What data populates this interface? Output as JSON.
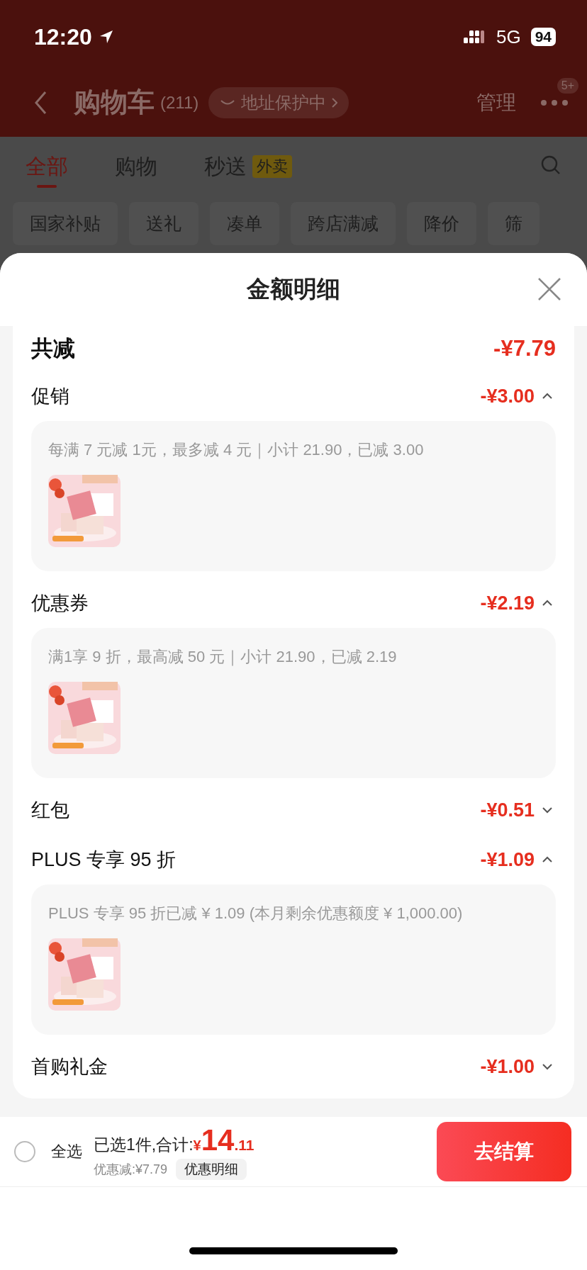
{
  "status_bar": {
    "time": "12:20",
    "network": "5G",
    "battery": "94"
  },
  "header": {
    "title": "购物车",
    "count": "(211)",
    "address_badge": "地址保护中",
    "manage": "管理",
    "more_badge": "5+"
  },
  "tabs": [
    {
      "label": "全部",
      "selected": true
    },
    {
      "label": "购物",
      "selected": false
    },
    {
      "label": "秒送",
      "selected": false,
      "tag": "外卖"
    }
  ],
  "chips": [
    "国家补贴",
    "送礼",
    "凑单",
    "跨店满减",
    "降价",
    "筛"
  ],
  "sheet": {
    "title": "金额明细",
    "total_label": "共减",
    "total_amount": "-¥7.79",
    "sections": [
      {
        "label": "促销",
        "amount": "-¥3.00",
        "expanded": true,
        "detail": "每满 7 元减 1元，最多减 4 元｜小计 21.90，已减 3.00"
      },
      {
        "label": "优惠券",
        "amount": "-¥2.19",
        "expanded": true,
        "detail": "满1享 9 折，最高减 50 元｜小计 21.90，已减 2.19"
      },
      {
        "label": "红包",
        "amount": "-¥0.51",
        "expanded": false
      },
      {
        "label": "PLUS 专享 95 折",
        "amount": "-¥1.09",
        "expanded": true,
        "detail": "PLUS 专享 95 折已减 ¥ 1.09 (本月剩余优惠额度 ¥ 1,000.00)"
      },
      {
        "label": "首购礼金",
        "amount": "-¥1.00",
        "expanded": false
      }
    ]
  },
  "bottom_bar": {
    "select_all": {
      "label": "全选",
      "checked": false
    },
    "summary": "已选1件,合计:",
    "currency": "¥",
    "price_int": "14",
    "price_dec": ".11",
    "discount": "优惠减:¥7.79",
    "detail_button": "优惠明细",
    "checkout": "去结算"
  }
}
